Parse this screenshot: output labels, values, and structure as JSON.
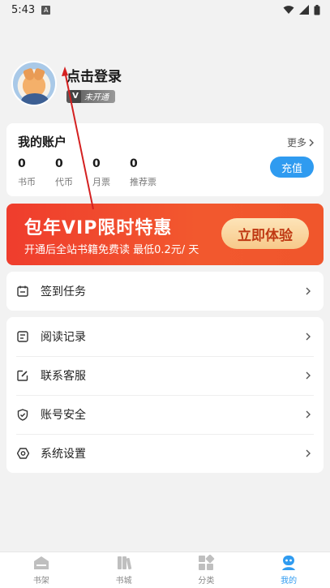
{
  "status_bar": {
    "time": "5:43",
    "notif_letter": "A"
  },
  "profile": {
    "login_text": "点击登录",
    "member_status": "未开通"
  },
  "account": {
    "title": "我的账户",
    "more": "更多",
    "stats": [
      {
        "value": "0",
        "label": "书币"
      },
      {
        "value": "0",
        "label": "代币"
      },
      {
        "value": "0",
        "label": "月票"
      },
      {
        "value": "0",
        "label": "推荐票"
      }
    ],
    "recharge_label": "充值"
  },
  "vip_banner": {
    "title": "包年VIP限时特惠",
    "subtitle": "开通后全站书籍免费读 最低0.2元/ 天",
    "button_label": "立即体验"
  },
  "menu_group_1": [
    {
      "label": "签到任务",
      "icon": "calendar-icon"
    }
  ],
  "menu_group_2": [
    {
      "label": "阅读记录",
      "icon": "document-icon"
    },
    {
      "label": "联系客服",
      "icon": "edit-icon"
    },
    {
      "label": "账号安全",
      "icon": "shield-icon"
    },
    {
      "label": "系统设置",
      "icon": "settings-icon"
    }
  ],
  "bottom_nav": [
    {
      "label": "书架",
      "icon": "bookshelf-icon",
      "active": false
    },
    {
      "label": "书城",
      "icon": "bookstore-icon",
      "active": false
    },
    {
      "label": "分类",
      "icon": "category-icon",
      "active": false
    },
    {
      "label": "我的",
      "icon": "profile-icon",
      "active": true
    }
  ],
  "colors": {
    "accent": "#2f9bf0",
    "vip_red": "#ef3d2d",
    "annotation": "#d42020"
  }
}
